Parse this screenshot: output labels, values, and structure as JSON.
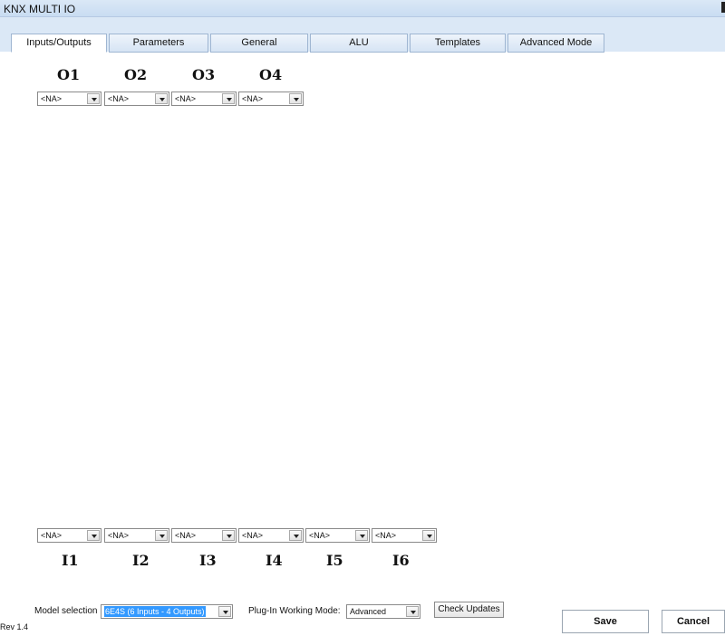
{
  "window": {
    "title": "KNX MULTI IO"
  },
  "tabs": [
    {
      "label": "Inputs/Outputs"
    },
    {
      "label": "Parameters"
    },
    {
      "label": "General"
    },
    {
      "label": "ALU"
    },
    {
      "label": "Templates"
    },
    {
      "label": "Advanced Mode"
    }
  ],
  "outputs": {
    "labels": [
      "O1",
      "O2",
      "O3",
      "O4"
    ],
    "values": [
      "<NA>",
      "<NA>",
      "<NA>",
      "<NA>"
    ]
  },
  "inputs": {
    "labels": [
      "I1",
      "I2",
      "I3",
      "I4",
      "I5",
      "I6"
    ],
    "values": [
      "<NA>",
      "<NA>",
      "<NA>",
      "<NA>",
      "<NA>",
      "<NA>"
    ]
  },
  "footer": {
    "model_label": "Model selection",
    "model_value": "6E4S (6 Inputs - 4 Outputs)",
    "mode_label": "Plug-In Working Mode:",
    "mode_value": "Advanced",
    "check_updates": "Check Updates",
    "save": "Save",
    "cancel": "Cancel",
    "revision": "Rev 1.4"
  }
}
